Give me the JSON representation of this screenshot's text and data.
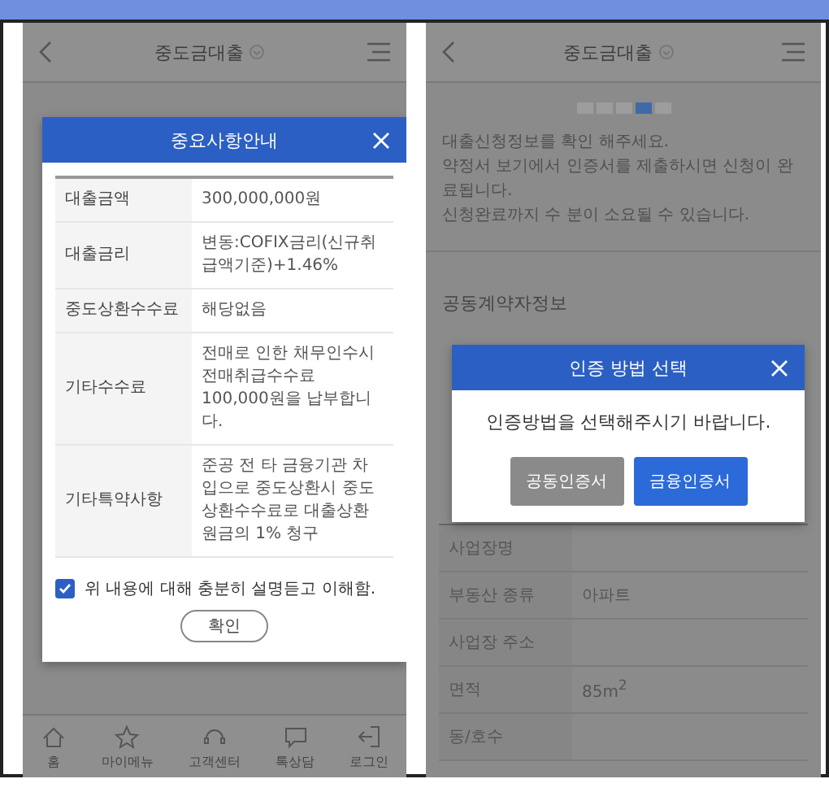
{
  "screens": [
    {
      "kind": "info",
      "header": {
        "title": "중도금대출"
      },
      "bottom_nav": [
        {
          "label": "홈"
        },
        {
          "label": "마이메뉴"
        },
        {
          "label": "고객센터"
        },
        {
          "label": "톡상담"
        },
        {
          "label": "로그인"
        }
      ],
      "modal": {
        "title": "중요사항안내",
        "rows": [
          {
            "label": "대출금액",
            "value": "300,000,000원"
          },
          {
            "label": "대출금리",
            "value": "변동:COFIX금리(신규취급액기준)+1.46%"
          },
          {
            "label": "중도상환수수료",
            "value": "해당없음"
          },
          {
            "label": "기타수수료",
            "value": "전매로 인한 채무인수시 전매취급수수료 100,000원을 납부합니다."
          },
          {
            "label": "기타특약사항",
            "value": "준공 전 타 금융기관 차입으로 중도상환시 중도상환수수료로 대출상환 원금의 1% 청구"
          }
        ],
        "agree": {
          "label": "위 내용에 대해 충분히 설명듣고 이해함.",
          "checked": true
        },
        "confirm": "확인"
      }
    },
    {
      "kind": "auth",
      "header": {
        "title": "중도금대출"
      },
      "steps": [
        {
          "selected": false
        },
        {
          "selected": false
        },
        {
          "selected": false
        },
        {
          "selected": true
        },
        {
          "selected": false
        }
      ],
      "notice": [
        "대출신청정보를 확인 해주세요.",
        "약정서 보기에서 인증서를 제출하시면 신청이 완료됩니다.",
        "신청완료까지 수 분이 소요될 수 있습니다."
      ],
      "section_title": "공동계약자정보",
      "table": [
        {
          "label": "사업장명"
        },
        {
          "label": "부동산 종류",
          "value": "아파트"
        },
        {
          "label": "사업장 주소"
        },
        {
          "label": "면적",
          "value": "85m$^{2}$"
        },
        {
          "label": "동/호수"
        }
      ],
      "modal": {
        "title": "인증 방법 선택",
        "message": "인증방법을 선택해주시기 바랍니다.",
        "buttons": [
          {
            "label": "공동인증서",
            "primary": false
          },
          {
            "label": "금융인증서",
            "primary": true
          }
        ]
      }
    }
  ]
}
